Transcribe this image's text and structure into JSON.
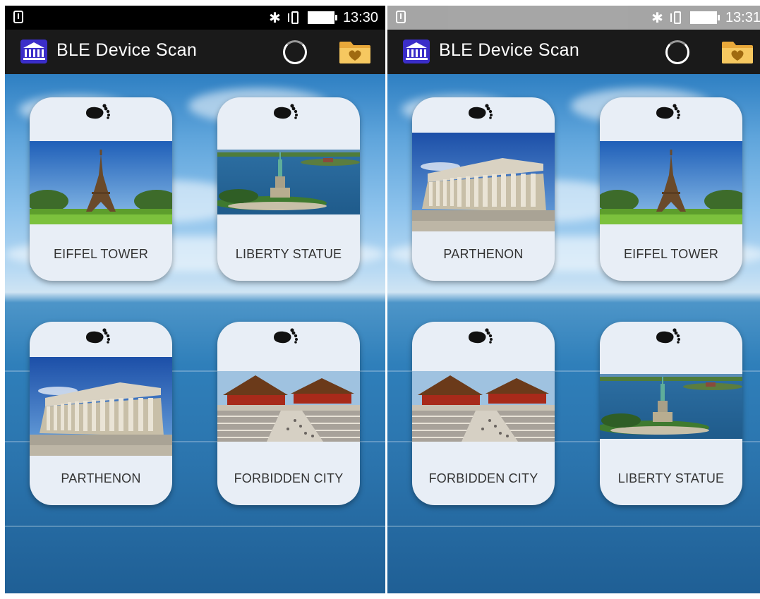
{
  "app": {
    "title": "BLE Device Scan"
  },
  "icons": {
    "app_icon": "bank-icon",
    "refresh": "spinner-icon",
    "favorites": "heart-folder-icon",
    "card_icon": "footprints-icon"
  },
  "colors": {
    "app_icon_bg": "#3b2ec9",
    "appbar_bg": "#1a1a1a",
    "card_bg": "#e8eef6"
  },
  "screens": [
    {
      "status_time": "13:30",
      "cards": [
        {
          "label": "EIFFEL TOWER",
          "photo": "eiffel"
        },
        {
          "label": "LIBERTY STATUE",
          "photo": "liberty"
        },
        {
          "label": "PARTHENON",
          "photo": "parthenon"
        },
        {
          "label": "FORBIDDEN CITY",
          "photo": "forbidden"
        }
      ]
    },
    {
      "status_time": "13:31",
      "cards": [
        {
          "label": "PARTHENON",
          "photo": "parthenon"
        },
        {
          "label": "EIFFEL TOWER",
          "photo": "eiffel"
        },
        {
          "label": "FORBIDDEN CITY",
          "photo": "forbidden"
        },
        {
          "label": "LIBERTY STATUE",
          "photo": "liberty"
        }
      ]
    }
  ]
}
